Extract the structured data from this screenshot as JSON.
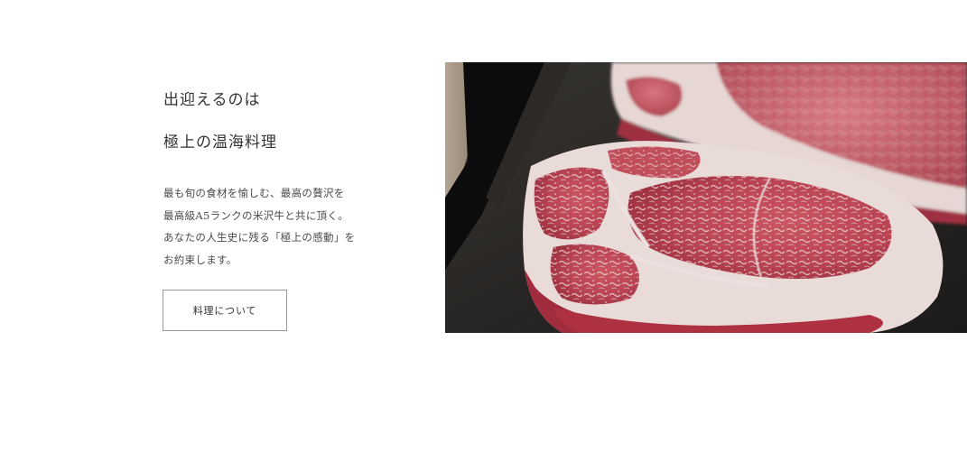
{
  "intro": {
    "heading_line1": "出迎えるのは",
    "heading_line2": "極上の温海料理",
    "body_lines": [
      "最も旬の食材を愉しむ、最高の贅沢を",
      "最高級A5ランクの米沢牛と共に頂く。",
      "あなたの人生史に残る「極上の感動」を",
      "お約束します。"
    ],
    "button_label": "料理について"
  },
  "photo": {
    "subject": "marbled-wagyu-steaks",
    "colors": {
      "meat_red": "#b83a48",
      "fat_white": "#f4e6e4",
      "tray_dark": "#2a2826"
    }
  }
}
